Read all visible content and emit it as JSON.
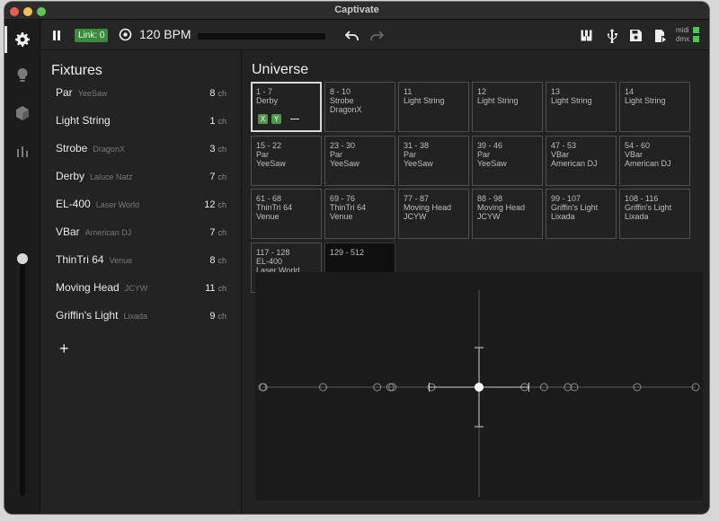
{
  "window": {
    "title": "Captivate"
  },
  "sidebar": {
    "items": [
      {
        "name": "settings",
        "icon": "gear-icon"
      },
      {
        "name": "lights",
        "icon": "bulb-icon"
      },
      {
        "name": "fixtures",
        "icon": "cube-icon"
      },
      {
        "name": "stats",
        "icon": "bar-chart-icon"
      }
    ],
    "master_level": 0.97
  },
  "toolbar": {
    "link_label": "Link: 0",
    "bpm_label": "120 BPM",
    "beat_progress": 0.0,
    "midi_label": "midi",
    "dmx_label": "dmx",
    "status_color": "#3fd04a"
  },
  "fixtures": {
    "title": "Fixtures",
    "items": [
      {
        "name": "Par",
        "maker": "YeeSaw",
        "channels": "8",
        "unit": "ch"
      },
      {
        "name": "Light String",
        "maker": "",
        "channels": "1",
        "unit": "ch"
      },
      {
        "name": "Strobe",
        "maker": "DragonX",
        "channels": "3",
        "unit": "ch"
      },
      {
        "name": "Derby",
        "maker": "Laluce Natz",
        "channels": "7",
        "unit": "ch"
      },
      {
        "name": "EL-400",
        "maker": "Laser World",
        "channels": "12",
        "unit": "ch"
      },
      {
        "name": "VBar",
        "maker": "American DJ",
        "channels": "7",
        "unit": "ch"
      },
      {
        "name": "ThinTri 64",
        "maker": "Venue",
        "channels": "8",
        "unit": "ch"
      },
      {
        "name": "Moving Head",
        "maker": "JCYW",
        "channels": "11",
        "unit": "ch"
      },
      {
        "name": "Griffin's Light",
        "maker": "Lixada",
        "channels": "9",
        "unit": "ch"
      }
    ],
    "add_label": "+"
  },
  "universe": {
    "title": "Universe",
    "cells": [
      {
        "range": "1 - 7",
        "name": "Derby",
        "maker": "",
        "selected": true,
        "x_label": "X",
        "y_label": "Y"
      },
      {
        "range": "8 - 10",
        "name": "Strobe",
        "maker": "DragonX"
      },
      {
        "range": "11",
        "name": "Light String",
        "maker": ""
      },
      {
        "range": "12",
        "name": "Light String",
        "maker": ""
      },
      {
        "range": "13",
        "name": "Light String",
        "maker": ""
      },
      {
        "range": "14",
        "name": "Light String",
        "maker": ""
      },
      {
        "range": "15 - 22",
        "name": "Par",
        "maker": "YeeSaw"
      },
      {
        "range": "23 - 30",
        "name": "Par",
        "maker": "YeeSaw"
      },
      {
        "range": "31 - 38",
        "name": "Par",
        "maker": "YeeSaw"
      },
      {
        "range": "39 - 46",
        "name": "Par",
        "maker": "YeeSaw"
      },
      {
        "range": "47 - 53",
        "name": "VBar",
        "maker": "American DJ"
      },
      {
        "range": "54 - 60",
        "name": "VBar",
        "maker": "American DJ"
      },
      {
        "range": "61 - 68",
        "name": "ThinTri 64",
        "maker": "Venue"
      },
      {
        "range": "69 - 76",
        "name": "ThinTri 64",
        "maker": "Venue"
      },
      {
        "range": "77 - 87",
        "name": "Moving Head",
        "maker": "JCYW"
      },
      {
        "range": "88 - 98",
        "name": "Moving Head",
        "maker": "JCYW"
      },
      {
        "range": "99 - 107",
        "name": "Griffin's Light",
        "maker": "Lixada"
      },
      {
        "range": "108 - 116",
        "name": "Griffin's Light",
        "maker": "Lixada"
      },
      {
        "range": "117 - 128",
        "name": "EL-400",
        "maker": "Laser World"
      },
      {
        "range": "129 - 512",
        "name": "",
        "maker": "",
        "empty": true
      }
    ]
  },
  "position_plot": {
    "selected_point": {
      "x": 0.0,
      "y": 0.0
    },
    "x_spread": 0.23,
    "y_spread": 0.2,
    "axis_markers": [
      -1.0,
      -0.995,
      -0.72,
      -0.47,
      -0.41,
      -0.4,
      -0.22,
      0.0,
      0.21,
      0.3,
      0.41,
      0.44,
      0.73,
      1.0
    ]
  }
}
